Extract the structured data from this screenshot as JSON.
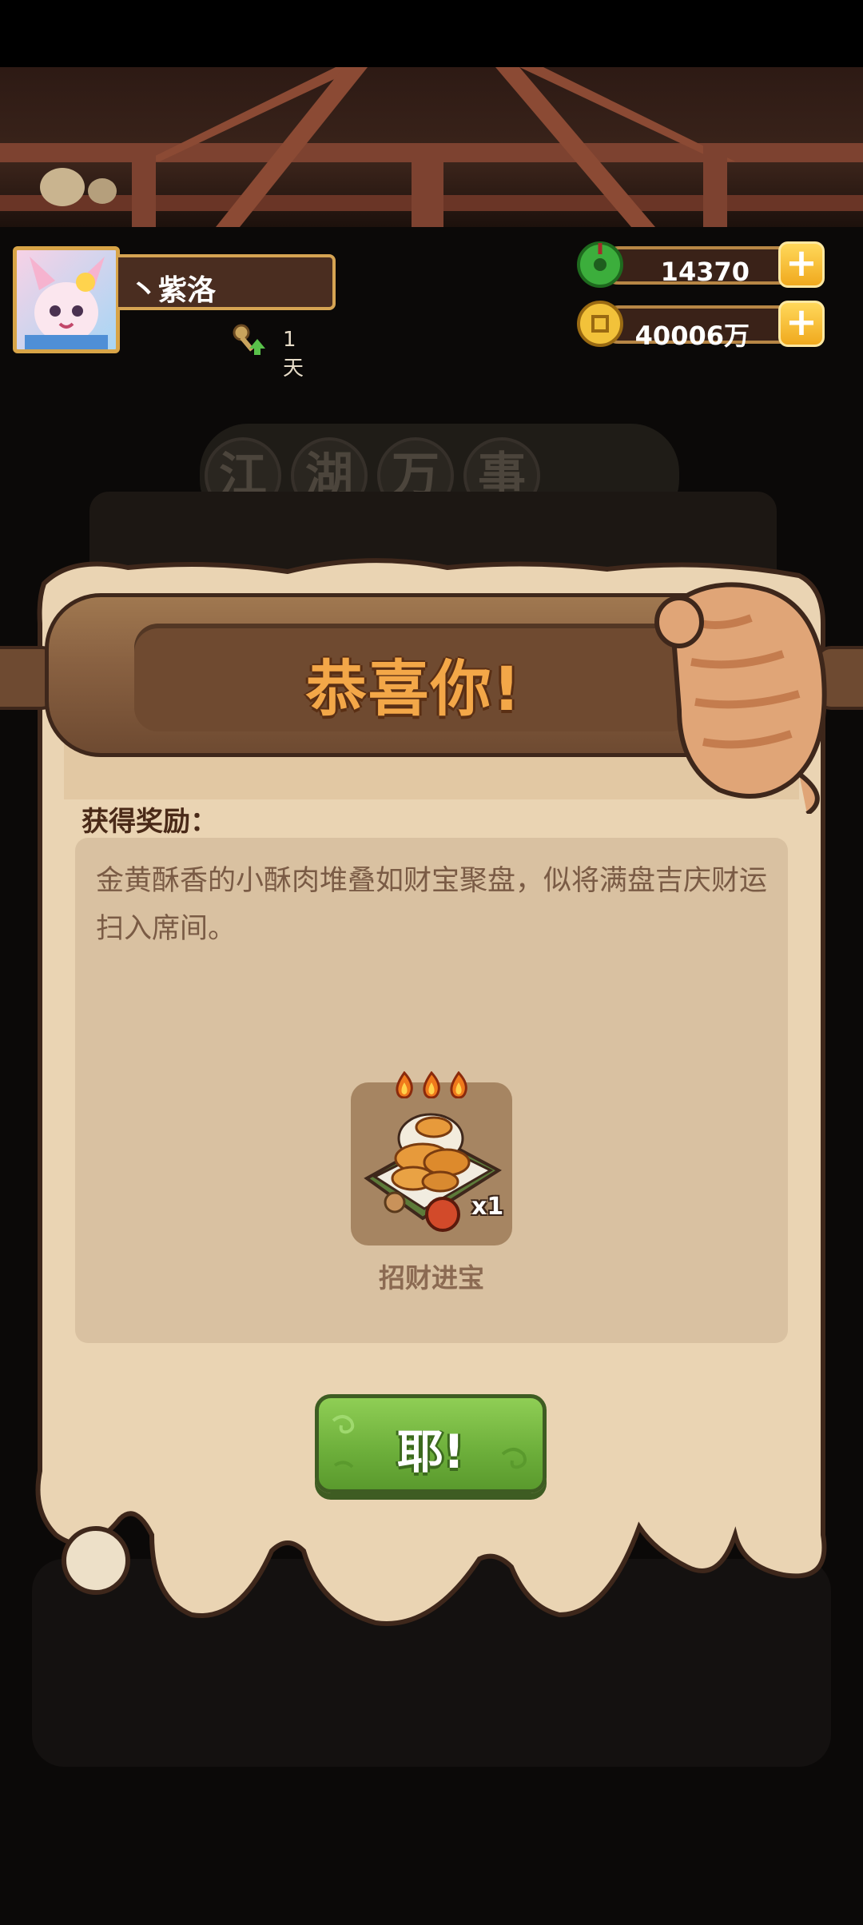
{
  "player": {
    "name": "丶紫洛",
    "days": "1天"
  },
  "currency": {
    "jade": {
      "value": "14370",
      "icon": "jade-coin-icon"
    },
    "gold": {
      "value": "40006万",
      "icon": "copper-coin-icon"
    }
  },
  "background": {
    "banner_chars": [
      "江",
      "湖",
      "万",
      "事"
    ]
  },
  "popup": {
    "title": "恭喜你!",
    "reward_label": "获得奖励：",
    "description": "金黄酥香的小酥肉堆叠如财宝聚盘，似将满盘吉庆财运扫入席间。",
    "item": {
      "name": "招财进宝",
      "quantity": "x1",
      "stars": 3
    },
    "confirm_label": "耶!"
  },
  "colors": {
    "title_orange": "#f3a748",
    "wood_brown": "#6f4a30",
    "cream": "#e9d6b8",
    "reward_box": "#d9c1a1",
    "button_green": "#7bbf46"
  }
}
